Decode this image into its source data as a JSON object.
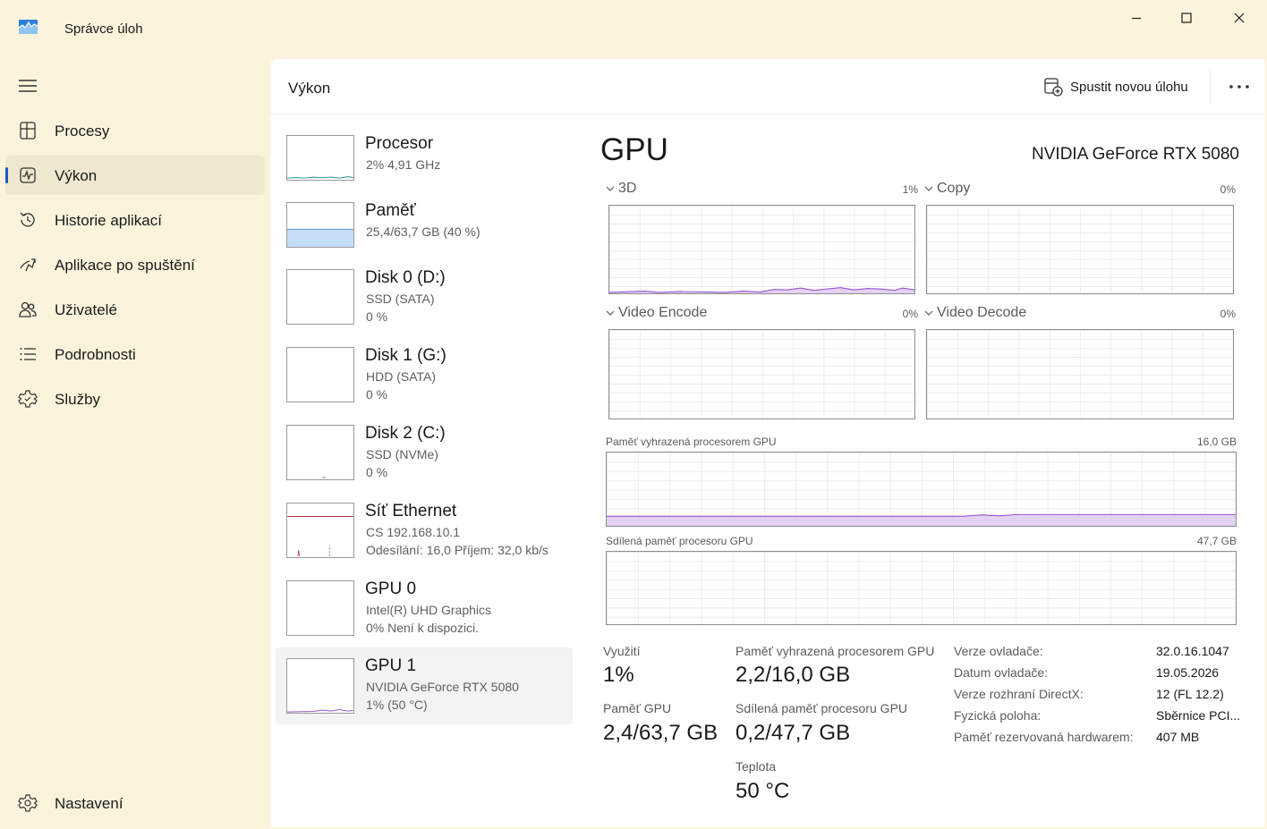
{
  "window": {
    "title": "Správce úloh",
    "controls": [
      "minimize",
      "maximize",
      "close"
    ]
  },
  "sidebar": {
    "items": [
      {
        "label": "Procesy",
        "icon": "processes-icon",
        "active": false
      },
      {
        "label": "Výkon",
        "icon": "performance-icon",
        "active": true
      },
      {
        "label": "Historie aplikací",
        "icon": "history-icon",
        "active": false
      },
      {
        "label": "Aplikace po spuštění",
        "icon": "startup-icon",
        "active": false
      },
      {
        "label": "Uživatelé",
        "icon": "users-icon",
        "active": false
      },
      {
        "label": "Podrobnosti",
        "icon": "details-icon",
        "active": false
      },
      {
        "label": "Služby",
        "icon": "services-icon",
        "active": false
      }
    ],
    "settings_label": "Nastavení"
  },
  "header": {
    "title": "Výkon",
    "run_task_label": "Spustit novou úlohu",
    "more_icon": "more-icon"
  },
  "devices": [
    {
      "title": "Procesor",
      "sub1": "2% 4,91 GHz",
      "sub2": ""
    },
    {
      "title": "Paměť",
      "sub1": "25,4/63,7 GB (40 %)",
      "sub2": "",
      "fill": 0.4
    },
    {
      "title": "Disk 0 (D:)",
      "sub1": "SSD (SATA)",
      "sub2": "0 %"
    },
    {
      "title": "Disk 1 (G:)",
      "sub1": "HDD (SATA)",
      "sub2": "0 %"
    },
    {
      "title": "Disk 2 (C:)",
      "sub1": "SSD (NVMe)",
      "sub2": "0 %"
    },
    {
      "title": "Síť Ethernet",
      "sub1": "CS 192.168.10.1",
      "sub2": "Odesílání: 16,0 Příjem: 32,0 kb/s"
    },
    {
      "title": "GPU 0",
      "sub1": "Intel(R) UHD Graphics",
      "sub2": "0% Není k dispozici."
    },
    {
      "title": "GPU 1",
      "sub1": "NVIDIA GeForce RTX 5080",
      "sub2": "1% (50 °C)",
      "selected": true
    }
  ],
  "detail": {
    "title": "GPU",
    "model": "NVIDIA GeForce RTX 5080",
    "engines": [
      {
        "label": "3D",
        "pct": "1%"
      },
      {
        "label": "Copy",
        "pct": "0%"
      },
      {
        "label": "Video Encode",
        "pct": "0%"
      },
      {
        "label": "Video Decode",
        "pct": "0%"
      }
    ],
    "dedicated_mem": {
      "label": "Paměť vyhrazená procesorem GPU",
      "max": "16,0 GB"
    },
    "shared_mem": {
      "label": "Sdílená paměť procesoru GPU",
      "max": "47,7 GB"
    },
    "stats": {
      "utilization_label": "Využití",
      "utilization_value": "1%",
      "gpu_mem_label": "Paměť GPU",
      "gpu_mem_value": "2,4/63,7 GB",
      "dedicated_label": "Paměť vyhrazená procesorem GPU",
      "dedicated_value": "2,2/16,0 GB",
      "shared_label": "Sdílená paměť procesoru GPU",
      "shared_value": "0,2/47,7 GB",
      "temp_label": "Teplota",
      "temp_value": "50 °C"
    },
    "info": [
      {
        "key": "Verze ovladače:",
        "value": "32.0.16.1047"
      },
      {
        "key": "Datum ovladače:",
        "value": "19.05.2026"
      },
      {
        "key": "Verze rozhraní DirectX:",
        "value": "12 (FL 12.2)"
      },
      {
        "key": "Fyzická poloha:",
        "value": "Sběrnice PCI..."
      },
      {
        "key": "Paměť rezervovaná hardwarem:",
        "value": "407 MB"
      }
    ]
  },
  "colors": {
    "background": "#fbf3dc",
    "accent": "#1b5bbf",
    "gpu_line": "#8e44c9",
    "gpu_fill": "#e3d2f3",
    "memory_fill": "#c5ddf6",
    "network_line": "#a8394e",
    "cpu_line": "#1f8f9a"
  }
}
